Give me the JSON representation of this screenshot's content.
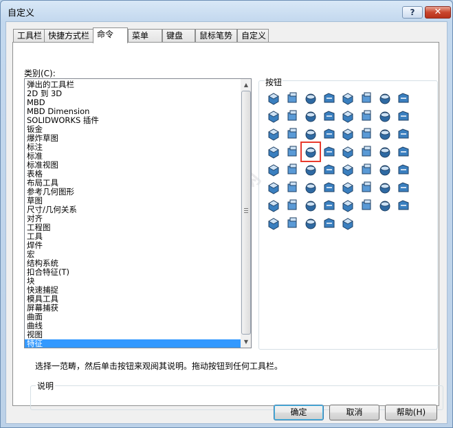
{
  "window": {
    "title": "自定义",
    "help_glyph": "?",
    "close_glyph": "✕"
  },
  "tabs": [
    "工具栏",
    "快捷方式栏",
    "命令",
    "菜单",
    "键盘",
    "鼠标笔势",
    "自定义"
  ],
  "active_tab": "命令",
  "category": {
    "label": "类别(C):",
    "items": [
      "弹出的工具栏",
      "2D 到 3D",
      "MBD",
      "MBD Dimension",
      "SOLIDWORKS 插件",
      "钣金",
      "爆炸草图",
      "标注",
      "标准",
      "标准视图",
      "表格",
      "布局工具",
      "参考几何图形",
      "草图",
      "尺寸/几何关系",
      "对齐",
      "工程图",
      "工具",
      "焊件",
      "宏",
      "结构系统",
      "扣合特征(T)",
      "块",
      "快速捕捉",
      "模具工具",
      "屏幕捕获",
      "曲面",
      "曲线",
      "视图",
      "特征"
    ],
    "selected": "特征",
    "scroll_up": "▲",
    "scroll_down": "▼"
  },
  "buttons_group": {
    "label": "按钮",
    "highlighted_index": 26,
    "icons": [
      "boss-extrude-icon",
      "revolve-icon",
      "sweep-icon",
      "loft-icon",
      "boundary-boss-icon",
      "extrude-cut-icon",
      "revolve-cut-icon",
      "sweep-cut-icon",
      "loft-cut-icon",
      "boundary-cut-icon",
      "hole-wizard-icon",
      "fillet-icon",
      "chamfer-icon",
      "rib-icon",
      "draft-icon",
      "shell-icon",
      "wrap-icon",
      "intersect-icon",
      "dome-icon",
      "deform-icon",
      "flex-icon",
      "indent-icon",
      "mold-icon",
      "combine-icon",
      "thicken-icon",
      "dome-shape-icon",
      "move-face-icon",
      "split-icon",
      "join-icon",
      "freeform-icon",
      "cavity-icon",
      "scale-icon",
      "mirror-icon",
      "ruler-icon",
      "pattern-linear-icon",
      "pattern-circular-icon",
      "pattern-curve-icon",
      "pattern-table-icon",
      "pattern-sketch-icon",
      "pattern-fill-icon",
      "assembly-icon",
      "tree-icon",
      "table-icon",
      "library-icon",
      "save-bodies-icon",
      "delete-body-icon",
      "replace-face-icon",
      "solid-body-icon",
      "box-icon",
      "delete-face-icon",
      "curve-driven-icon",
      "feature-folder-icon",
      "feature-add-icon",
      "move-copy-icon",
      "grid-icon",
      "check-icon",
      "grid-3d-icon",
      "rollback-icon",
      "insert-part-icon",
      "body-icon",
      "flip-icon"
    ]
  },
  "description_line": "选择一范畴，然后单击按钮来观阅其说明。拖动按钮到任何工具栏。",
  "description_box": {
    "label": "说明",
    "text": ""
  },
  "footer": {
    "ok": "确定",
    "cancel": "取消",
    "help": "帮助(H)"
  },
  "watermark_text": "软件自学网"
}
